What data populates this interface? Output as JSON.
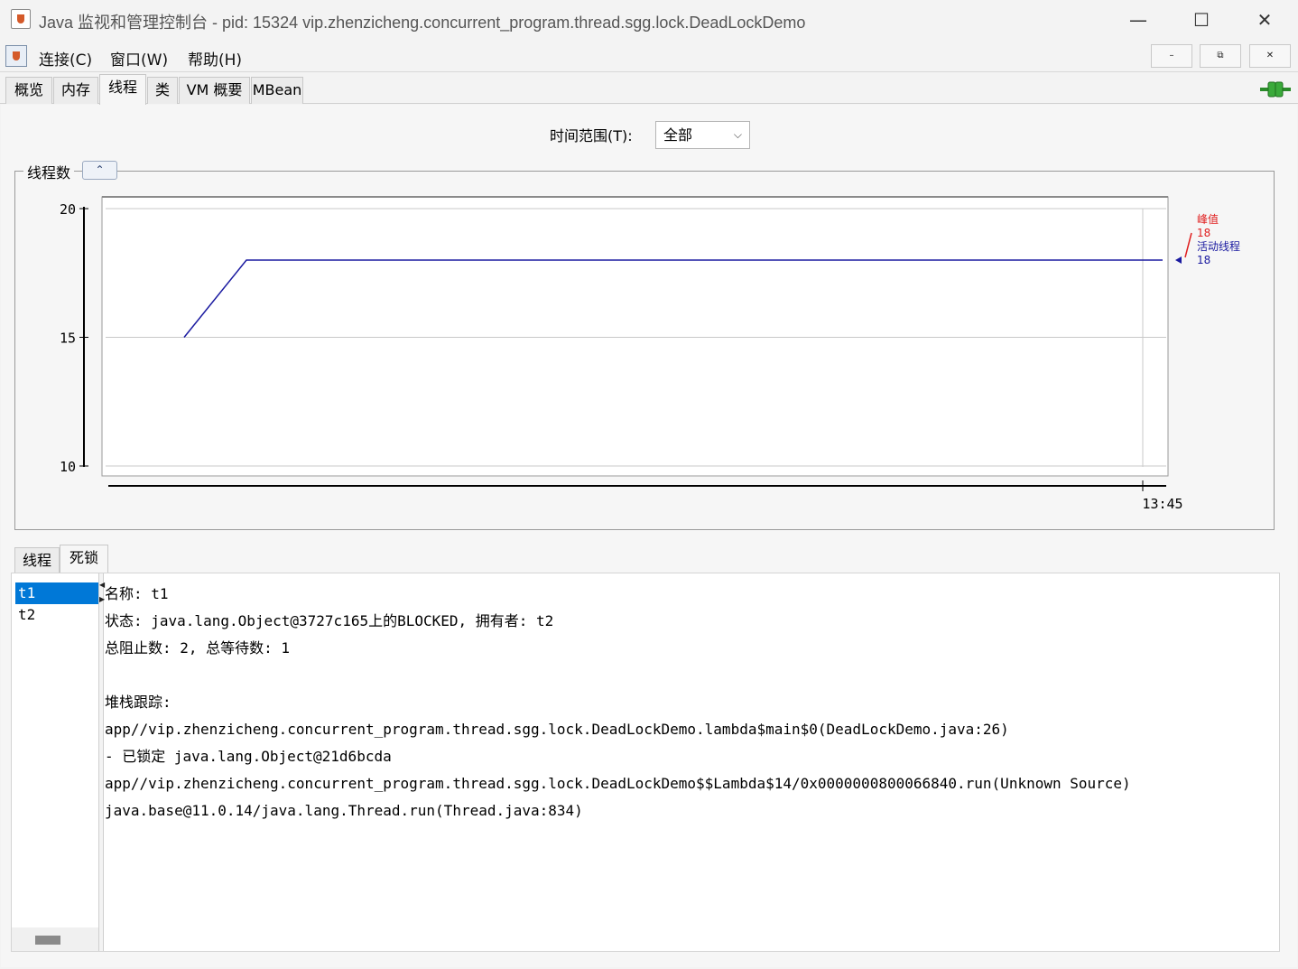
{
  "window": {
    "title": "Java 监视和管理控制台 - pid: 15324 vip.zhenzicheng.concurrent_program.thread.sgg.lock.DeadLockDemo",
    "minimize_glyph": "—",
    "maximize_glyph": "☐",
    "close_glyph": "✕"
  },
  "menubar": {
    "items": [
      "连接(C)",
      "窗口(W)",
      "帮助(H)"
    ],
    "mdi_minimize": "–",
    "mdi_restore": "⧉",
    "mdi_close": "✕"
  },
  "tabs": [
    "概览",
    "内存",
    "线程",
    "类",
    "VM 概要",
    "MBean"
  ],
  "active_tab": "线程",
  "time_range": {
    "label": "时间范围(T):",
    "value": "全部"
  },
  "chart_panel": {
    "title": "线程数",
    "collapse_glyph": "⌃"
  },
  "chart_data": {
    "type": "line",
    "ylim": [
      10,
      20
    ],
    "yticks": [
      20,
      15,
      10
    ],
    "xtick_label": "13:45",
    "series": [
      {
        "name": "峰值",
        "value": 18,
        "color": "#e02020",
        "values": [
          18,
          18
        ]
      },
      {
        "name": "活动线程",
        "value": 18,
        "color": "#1a1aa0",
        "values": [
          15,
          18,
          18
        ]
      }
    ],
    "legend_position": "right"
  },
  "subtabs": [
    "线程",
    "死锁"
  ],
  "active_subtab": "死锁",
  "threads": [
    "t1",
    "t2"
  ],
  "selected_thread": "t1",
  "detail": {
    "lines": [
      "名称: t1",
      "状态: java.lang.Object@3727c165上的BLOCKED, 拥有者: t2",
      "总阻止数: 2, 总等待数: 1",
      "",
      "堆栈跟踪:",
      "app//vip.zhenzicheng.concurrent_program.thread.sgg.lock.DeadLockDemo.lambda$main$0(DeadLockDemo.java:26)",
      "   - 已锁定 java.lang.Object@21d6bcda",
      "app//vip.zhenzicheng.concurrent_program.thread.sgg.lock.DeadLockDemo$$Lambda$14/0x0000000800066840.run(Unknown Source)",
      "java.base@11.0.14/java.lang.Thread.run(Thread.java:834)"
    ]
  }
}
